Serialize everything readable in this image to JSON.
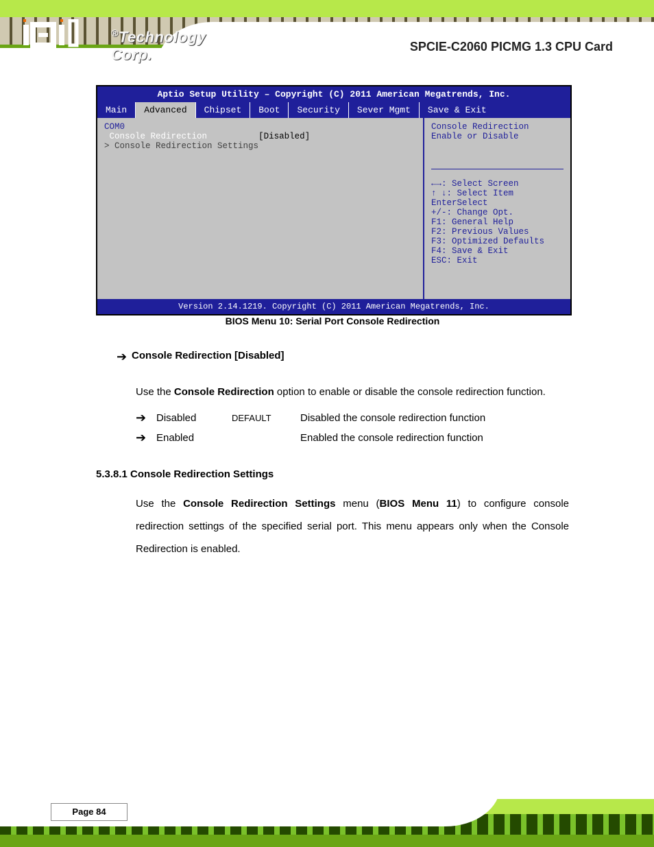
{
  "product_name": "SPCIE-C2060 PICMG 1.3 CPU Card",
  "logo_tag": "Technology Corp.",
  "bios": {
    "title": "Aptio Setup Utility – Copyright (C) 2011 American Megatrends, Inc.",
    "tabs": [
      "Main",
      "Advanced",
      "Chipset",
      "Boot",
      "Security",
      "Sever Mgmt",
      "Save & Exit"
    ],
    "active_tab": "Advanced",
    "left": {
      "section": "COM0",
      "item_label": "Console Redirection",
      "item_value": "[Disabled]",
      "submenu": "> Console Redirection Settings"
    },
    "right": {
      "help": "Console Redirection\nEnable or Disable",
      "keys": [
        {
          "k": "←→",
          "d": ": Select Screen"
        },
        {
          "k": "↑ ↓",
          "d": ": Select Item"
        },
        {
          "k": "Enter",
          "d": "Select"
        },
        {
          "k": "+/-",
          "d": ": Change Opt."
        },
        {
          "k": "F1",
          "d": ": General Help"
        },
        {
          "k": "F2",
          "d": ": Previous Values"
        },
        {
          "k": "F3",
          "d": ": Optimized Defaults"
        },
        {
          "k": "F4",
          "d": ": Save & Exit"
        },
        {
          "k": "ESC",
          "d": ": Exit"
        }
      ]
    },
    "footer": "Version 2.14.1219. Copyright (C) 2011 American Megatrends, Inc."
  },
  "caption": "BIOS Menu 10: Serial Port Console Redirection",
  "s1": {
    "heading": "Console Redirection [Disabled]",
    "intro_pre": "Use the ",
    "intro_bold": "Console Redirection",
    "intro_post": " option to enable or disable the console redirection function.",
    "opts": [
      {
        "name": "Disabled",
        "def": "DEFAULT",
        "desc": "Disabled the console redirection function"
      },
      {
        "name": "Enabled",
        "def": "",
        "desc": "Enabled the console redirection function"
      }
    ]
  },
  "s2": {
    "heading": "5.3.8.1 Console Redirection Settings",
    "p_pre": "Use the ",
    "p_bold1": "Console Redirection Settings",
    "p_mid": " menu (",
    "p_bold2": "BIOS Menu 11",
    "p_post": ") to configure console redirection settings of the specified serial port. This menu appears only when the Console Redirection is enabled."
  },
  "page_label": "Page 84"
}
